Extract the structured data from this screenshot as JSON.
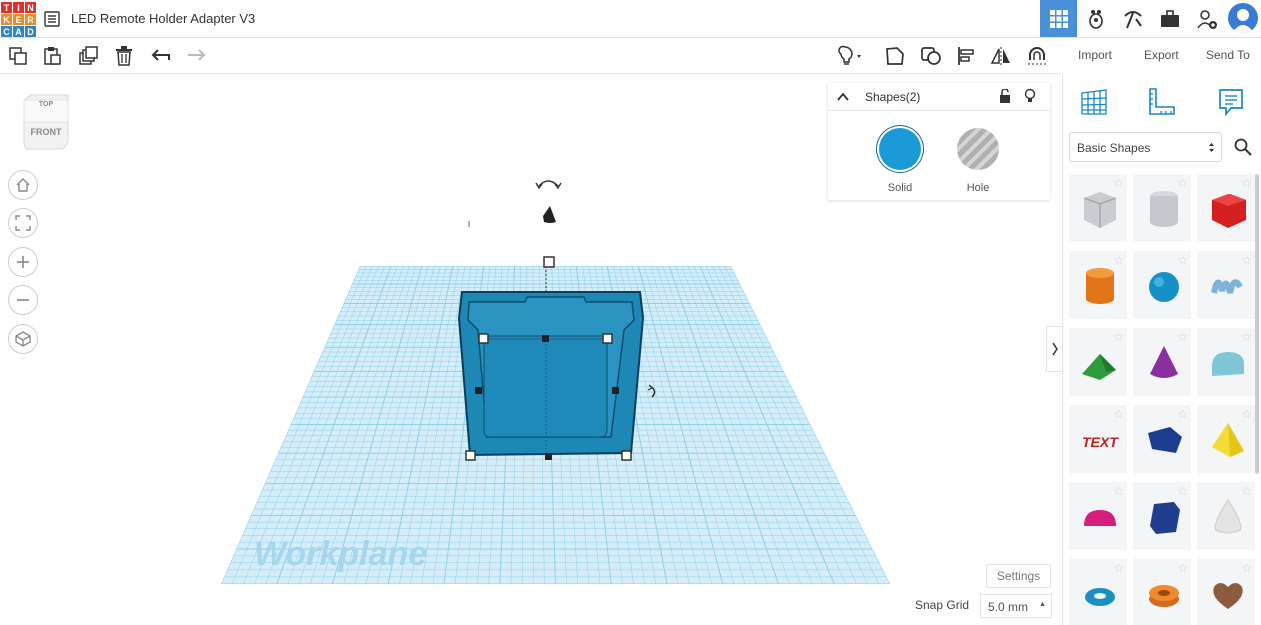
{
  "app": {
    "logo_letters": [
      "T",
      "I",
      "N",
      "K",
      "E",
      "R",
      "C",
      "A",
      "D"
    ],
    "logo_colors": [
      "#e2302f",
      "#e2302f",
      "#e2302f",
      "#f08a24",
      "#f08a24",
      "#f08a24",
      "#2e87c8",
      "#2e87c8",
      "#2e87c8"
    ],
    "doc_title": "LED Remote Holder Adapter V3"
  },
  "topbar": {
    "icons": [
      "grid-view-icon",
      "gallery-icon",
      "tinker-pickaxe-icon",
      "briefcase-icon",
      "add-user-icon",
      "avatar"
    ],
    "accent": "#4a90d9"
  },
  "toolbar": {
    "left_tools": [
      "copy-icon",
      "paste-icon",
      "duplicate-icon",
      "delete-icon",
      "undo-icon",
      "redo-icon"
    ],
    "right_tools": [
      "light-bulb-icon",
      "note-icon",
      "group-icon",
      "align-icon",
      "mirror-icon",
      "magnet-icon"
    ],
    "import_label": "Import",
    "export_label": "Export",
    "send_to_label": "Send To"
  },
  "shapes_panel": {
    "title": "Shapes(2)",
    "solid_label": "Solid",
    "hole_label": "Hole",
    "solid_color": "#1a9ad6"
  },
  "viewcube": {
    "top_label": "TOP",
    "front_label": "FRONT"
  },
  "nav": [
    "home-icon",
    "fit-view-icon",
    "zoom-in-icon",
    "zoom-out-icon",
    "ortho-view-icon"
  ],
  "workplane": {
    "label": "Workplane",
    "grid_color": "#8ecfea",
    "object_color": "#1d87b5"
  },
  "sidebar": {
    "tabs": [
      "workplane-grid-icon",
      "ruler-icon",
      "notes-icon"
    ],
    "category": "Basic Shapes",
    "shapes": [
      "box-hole",
      "cylinder-hole",
      "box",
      "cylinder",
      "sphere",
      "scribble",
      "roof",
      "cone",
      "round-roof",
      "text",
      "polygon",
      "pyramid",
      "half-sphere",
      "prism",
      "paraboloid",
      "torus",
      "tube",
      "heart"
    ]
  },
  "footer": {
    "settings_label": "Settings",
    "snap_grid_label": "Snap Grid",
    "snap_grid_value": "5.0 mm"
  }
}
